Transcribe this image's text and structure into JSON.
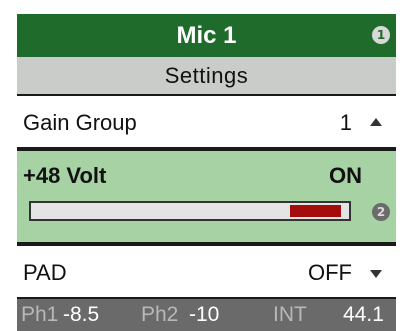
{
  "header": {
    "title": "Mic 1",
    "badge": "1"
  },
  "subheader": {
    "title": "Settings"
  },
  "gain_group": {
    "label": "Gain Group",
    "value": "1"
  },
  "phantom": {
    "label": "+48 Volt",
    "value": "ON",
    "badge": "2",
    "meter_level": 0.17
  },
  "pad": {
    "label": "PAD",
    "value": "OFF"
  },
  "status": {
    "ph1_label": "Ph1",
    "ph1_value": "-8.5",
    "ph2_label": "Ph2",
    "ph2_value": "-10",
    "clock_label": "INT",
    "clock_value": "44.1"
  },
  "colors": {
    "header": "#1e6b2c",
    "highlight": "#a7d3a4",
    "meter": "#a30d0d",
    "status_bar": "#6a6a6a"
  }
}
